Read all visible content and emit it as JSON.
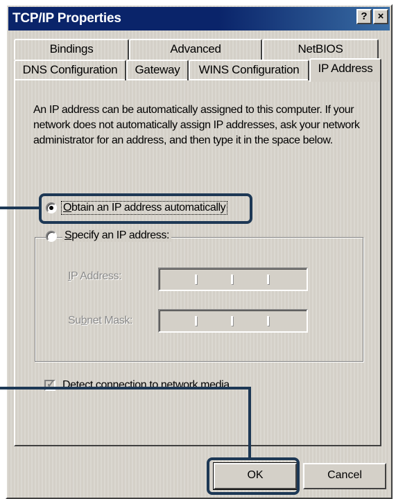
{
  "window": {
    "title": "TCP/IP Properties",
    "help_label": "?",
    "close_label": "×"
  },
  "tabs": {
    "row1": [
      {
        "label": "Bindings"
      },
      {
        "label": "Advanced"
      },
      {
        "label": "NetBIOS"
      }
    ],
    "row2": [
      {
        "label": "DNS Configuration"
      },
      {
        "label": "Gateway"
      },
      {
        "label": "WINS Configuration"
      },
      {
        "label": "IP Address",
        "selected": true
      }
    ]
  },
  "ip_panel": {
    "description": "An IP address can be automatically assigned to this computer. If your network does not automatically assign IP addresses, ask your network administrator for an address, and then type it in the space below.",
    "obtain_auto": {
      "label_first": "O",
      "label_rest": "btain an IP address automatically",
      "selected": true
    },
    "specify": {
      "label_first": "S",
      "label_rest": "pecify an IP address:",
      "selected": false
    },
    "ip_address": {
      "label_first": "I",
      "label_rest": "P Address:",
      "value": ""
    },
    "subnet_mask": {
      "label_pre": "Su",
      "label_under": "b",
      "label_rest": "net Mask:",
      "value": ""
    },
    "detect": {
      "label_first": "D",
      "label_rest": "etect connection to network media",
      "checked": true
    }
  },
  "buttons": {
    "ok": "OK",
    "cancel": "Cancel"
  },
  "colors": {
    "titlebar": "#0a246a",
    "dialog_face": "#d4d0c8",
    "callout": "#1d3855"
  }
}
